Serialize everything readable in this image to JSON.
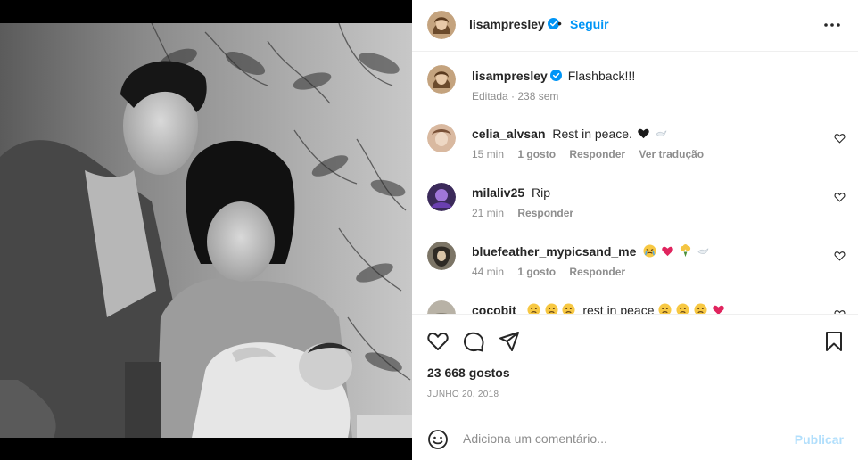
{
  "post": {
    "username": "lisampresley",
    "follow_label": "Seguir",
    "dot": "•",
    "caption": "Flashback!!!",
    "caption_meta": "Editada · 238 sem",
    "likes": "23 668 gostos",
    "date": "JUNHO 20, 2018"
  },
  "comments": [
    {
      "username": "celia_alvsan",
      "text": "Rest in peace.",
      "time": "15 min",
      "likes": "1 gosto",
      "reply": "Responder",
      "translate": "Ver tradução"
    },
    {
      "username": "milaliv25",
      "text": "Rip",
      "time": "21 min",
      "reply": "Responder"
    },
    {
      "username": "bluefeather_mypicsand_me",
      "text": "",
      "time": "44 min",
      "likes": "1 gosto",
      "reply": "Responder"
    },
    {
      "username": "cocobit",
      "text": "rest in peace"
    }
  ],
  "composer": {
    "placeholder": "Adiciona um comentário...",
    "publish_label": "Publicar"
  },
  "colors": {
    "accent": "#0095f6",
    "publish_disabled": "#b2dffc",
    "muted": "#8e8e8e",
    "heart_red": "#e0245e"
  },
  "icons": [
    "more-icon",
    "verified-icon",
    "heart-icon",
    "comment-icon",
    "share-icon",
    "bookmark-icon",
    "emoji-icon"
  ]
}
